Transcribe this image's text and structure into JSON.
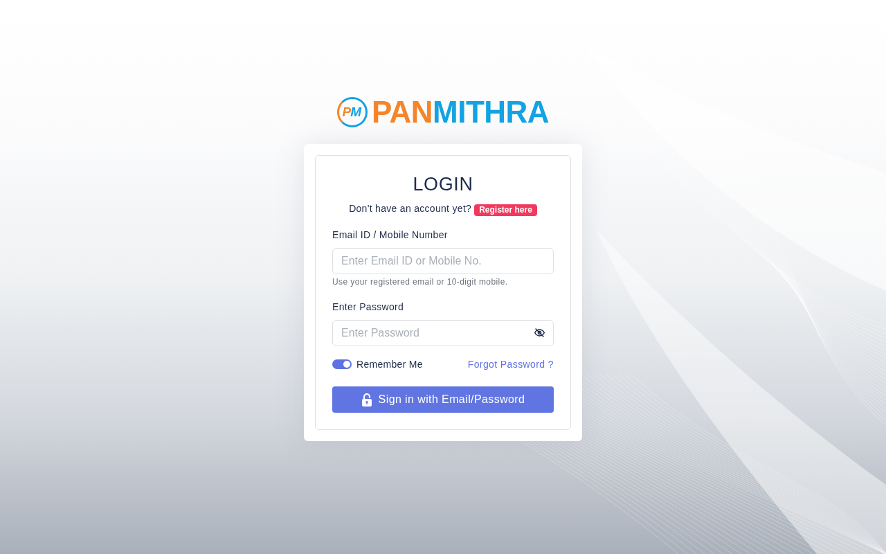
{
  "logo": {
    "monogram": "PM",
    "wordmark": [
      "PAN",
      "MITHRA"
    ]
  },
  "login_form": {
    "title": "LOGIN",
    "register_prompt": "Don't have an account yet?",
    "register_link": "Register here",
    "fields": [
      {
        "kind": "text",
        "label": "Email ID / Mobile Number",
        "placeholder": "Enter Email ID or Mobile No.",
        "help": "Use your registered email or 10-digit mobile."
      },
      {
        "kind": "password",
        "label": "Enter Password",
        "placeholder": "Enter Password"
      }
    ],
    "remember_me": {
      "label": "Remember Me",
      "on": true
    },
    "forgot_password": "Forgot Password ?",
    "submit_button": "Sign in with Email/Password"
  }
}
